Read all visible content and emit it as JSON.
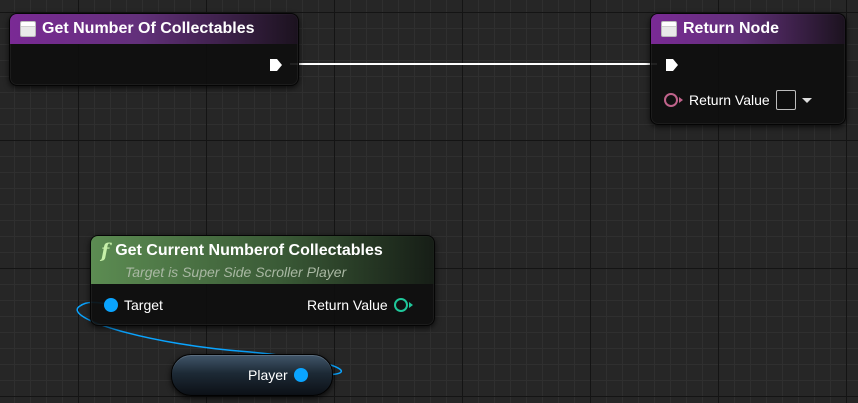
{
  "nodes": {
    "entry": {
      "title": "Get Number Of Collectables",
      "icon": "event-node-icon"
    },
    "return": {
      "title": "Return Node",
      "icon": "event-node-icon",
      "return_value_label": "Return Value"
    },
    "function_call": {
      "title": "Get Current Numberof Collectables",
      "subtitle": "Target is Super Side Scroller Player",
      "icon": "function-icon",
      "target_label": "Target",
      "return_value_label": "Return Value"
    },
    "variable": {
      "label": "Player"
    }
  },
  "colors": {
    "exec_wire": "#ffffff",
    "object_wire": "#0aa4ff",
    "function_header": "#5c8c52",
    "event_header": "#7a2a95",
    "bool_pin": "#c0638b",
    "int_pin": "#1fc79a"
  }
}
